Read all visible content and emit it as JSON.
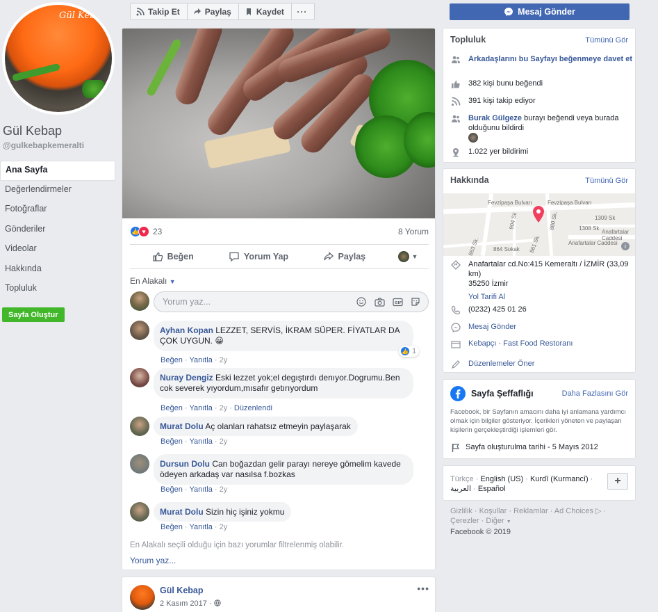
{
  "page": {
    "name": "Gül Kebap",
    "handle": "@gulkebapkemeralti",
    "avatar_logo_text": "Gül Kebap"
  },
  "left_nav": {
    "items": [
      {
        "label": "Ana Sayfa",
        "active": true
      },
      {
        "label": "Değerlendirmeler"
      },
      {
        "label": "Fotoğraflar"
      },
      {
        "label": "Gönderiler"
      },
      {
        "label": "Videolar"
      },
      {
        "label": "Hakkında"
      },
      {
        "label": "Topluluk"
      }
    ],
    "create_page_label": "Sayfa Oluştur"
  },
  "action_bar": {
    "follow_label": "Takip Et",
    "share_label": "Paylaş",
    "save_label": "Kaydet",
    "more_label": "···"
  },
  "send_message_label": "Mesaj Gönder",
  "post": {
    "reaction_count": "23",
    "comment_count": "8 Yorum",
    "like_label": "Beğen",
    "comment_label": "Yorum Yap",
    "share_label": "Paylaş",
    "sort_label": "En Alakalı",
    "composer_placeholder": "Yorum yaz...",
    "comments": [
      {
        "author": "Ayhan Kopan",
        "text": "LEZZET, SERVİS, İKRAM SÜPER. FİYATLAR DA ÇOK UYGUN. 😀",
        "like": "Beğen",
        "reply": "Yanıtla",
        "age": "2y",
        "reactions": "1"
      },
      {
        "author": "Nuray Dengiz",
        "text": "Eski lezzet yok;el degıştırdı denıyor.Dogrumu.Ben cok severek yıyordum,mısafır getırıyordum",
        "like": "Beğen",
        "reply": "Yanıtla",
        "age": "2y",
        "edited": "Düzenlendi"
      },
      {
        "author": "Murat Dolu",
        "text": "Aç olanları rahatsız etmeyin paylaşarak",
        "like": "Beğen",
        "reply": "Yanıtla",
        "age": "2y"
      },
      {
        "author": "Dursun Dolu",
        "text": "Can boğazdan gelir parayı nereye gömelim kavede ödeyen arkadaş var nasılsa f.bozkas",
        "like": "Beğen",
        "reply": "Yanıtla",
        "age": "2y"
      },
      {
        "author": "Murat Dolu",
        "text": "Sizin hiç işiniz yokmu",
        "like": "Beğen",
        "reply": "Yanıtla",
        "age": "2y"
      }
    ],
    "filter_note": "En Alakalı seçili olduğu için bazı yorumlar filtrelenmiş olabilir.",
    "write_comment": "Yorum yaz..."
  },
  "post2": {
    "author": "Gül Kebap",
    "date": "2 Kasım 2017 · "
  },
  "community": {
    "title": "Topluluk",
    "see_all": "Tümünü Gör",
    "invite": "Arkadaşlarını bu Sayfayı beğenmeye davet et",
    "likes": "382 kişi bunu beğendi",
    "follows": "391 kişi takip ediyor",
    "friend_name": "Burak Gülgeze",
    "friend_text": " burayı beğendi veya burada olduğunu bildirdi",
    "checkins": "1.022 yer bildirimi"
  },
  "about": {
    "title": "Hakkında",
    "see_all": "Tümünü Gör",
    "map_labels": [
      "Fevzipaşa Bulvarı",
      "Fevzipaşa Bulvarı",
      "1309 Sk",
      "1308 Sk",
      "Anafartalar Caddesi",
      "864 Sokak",
      "861 Sk.",
      "Anafartalar Caddesi",
      "863 Sk.",
      "880 Sk.",
      "904 Sk"
    ],
    "address": "Anafartalar cd.No:415 Kemeraltı / İZMİR (33,09 km)",
    "city": "35250 İzmir",
    "directions": "Yol Tarifi Al",
    "phone": "(0232) 425 01 26",
    "message": "Mesaj Gönder",
    "category_1": "Kebapçı",
    "category_sep": " · ",
    "category_2": "Fast Food Restoranı",
    "suggest_edits": "Düzenlemeler Öner"
  },
  "transparency": {
    "title": "Sayfa Şeffaflığı",
    "see_more": "Daha Fazlasını Gör",
    "text": "Facebook, bir Sayfanın amacını daha iyi anlamana yardımcı olmak için bilgiler gösteriyor. İçerikleri yöneten ve paylaşan kişilerin gerçekleştirdiği işlemleri gör.",
    "created": "Sayfa oluşturulma tarihi - 5 Mayıs 2012"
  },
  "languages": {
    "current": "Türkçe",
    "items": [
      "English (US)",
      "Kurdî (Kurmancî)",
      "العربية",
      "Español"
    ],
    "sep": " · "
  },
  "footer": {
    "links": [
      "Gizlilik",
      "Koşullar",
      "Reklamlar",
      "Ad Choices",
      "Çerezler",
      "Diğer"
    ],
    "copyright": "Facebook © 2019"
  },
  "colors": {
    "brand_blue": "#4267b2",
    "link": "#385898",
    "green_button": "#42b72a",
    "background": "#e9ebee"
  }
}
